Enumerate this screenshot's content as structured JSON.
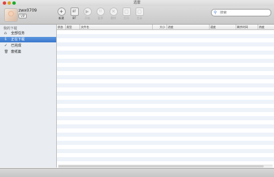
{
  "window": {
    "title": "迅雷"
  },
  "user": {
    "name": "zwx0709",
    "vip_badge": "VIP"
  },
  "toolbar": {
    "buttons": [
      {
        "label": "新建",
        "glyph": "+",
        "enabled": true
      },
      {
        "label": "BT",
        "glyph": "BT",
        "enabled": true
      },
      {
        "label": "开始",
        "glyph": "▶",
        "enabled": false
      },
      {
        "label": "暂停",
        "glyph": "II",
        "enabled": false
      },
      {
        "label": "删除",
        "glyph": "✕",
        "enabled": false
      },
      {
        "label": "打开",
        "glyph": "▢",
        "enabled": false
      },
      {
        "label": "目录",
        "glyph": "▢",
        "enabled": false
      }
    ]
  },
  "search": {
    "placeholder": "搜索"
  },
  "sidebar": {
    "heading": "我的下载",
    "items": [
      {
        "label": "全部任务",
        "icon": "home-icon",
        "glyph": "⌂",
        "active": false
      },
      {
        "label": "正在下载",
        "icon": "download-icon",
        "glyph": "⇩",
        "active": true
      },
      {
        "label": "已完成",
        "icon": "check-icon",
        "glyph": "✓",
        "active": false
      },
      {
        "label": "废纸篓",
        "icon": "trash-icon",
        "glyph": "🗑",
        "active": false
      }
    ]
  },
  "table": {
    "columns": [
      "状态",
      "类型",
      "文件名",
      "大小",
      "进度",
      "速度",
      "剩余时间",
      "热度"
    ]
  }
}
